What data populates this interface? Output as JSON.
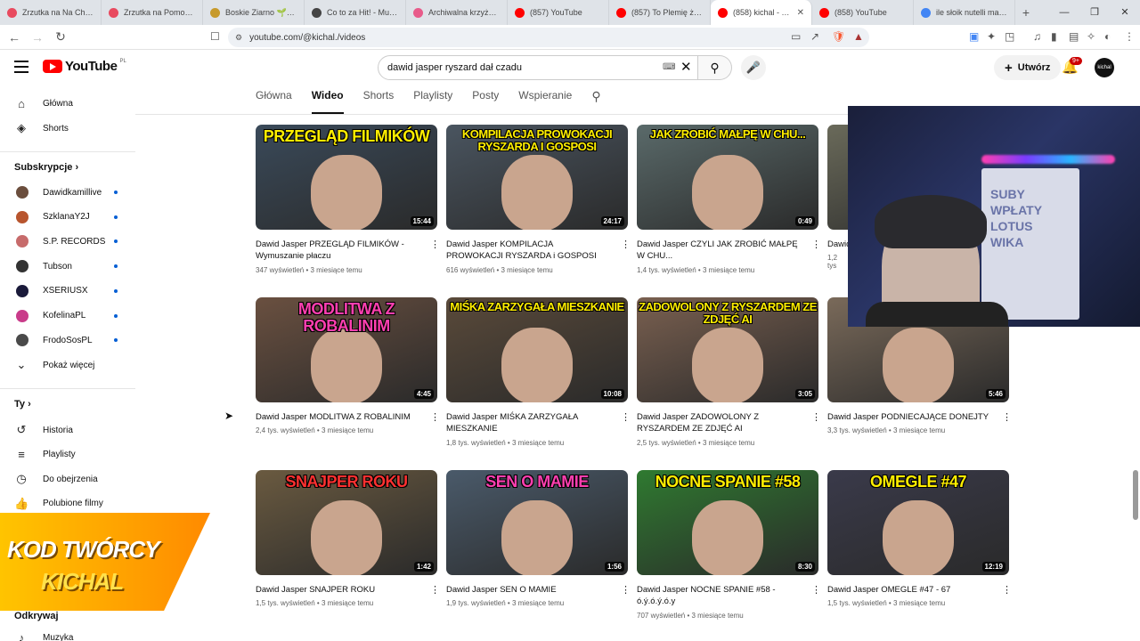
{
  "browser": {
    "tabs": [
      {
        "label": "Zrzutka na Na Chore D",
        "color": "#e84a5f",
        "active": false
      },
      {
        "label": "Zrzutka na Pomoc dla",
        "color": "#e84a5f",
        "active": false
      },
      {
        "label": "Boskie Ziarno 🌱 Reko",
        "color": "#c79a2b",
        "active": false
      },
      {
        "label": "Co to za Hit! - Muzyc",
        "color": "#444444",
        "active": false
      },
      {
        "label": "Archiwalna krzyżówka",
        "color": "#e85b8a",
        "active": false
      },
      {
        "label": "(857) YouTube",
        "color": "#ff0000",
        "active": false
      },
      {
        "label": "(857) To Plemię żyje na",
        "color": "#ff0000",
        "active": false
      },
      {
        "label": "(858) kichal - YouT",
        "color": "#ff0000",
        "active": true
      },
      {
        "label": "(858) YouTube",
        "color": "#ff0000",
        "active": false
      },
      {
        "label": "ile słoik nutelli ma kca",
        "color": "#4285f4",
        "active": false
      }
    ],
    "url": "youtube.com/@kichal./videos"
  },
  "youtube": {
    "logo_text": "YouTube",
    "logo_region": "PL",
    "search_query": "dawid jasper ryszard dał czadu",
    "create_label": "Utwórz",
    "notif_count": "9+",
    "me_avatar": "kichal"
  },
  "sidebar": {
    "main": [
      {
        "label": "Główna",
        "icon": "⌂"
      },
      {
        "label": "Shorts",
        "icon": "◈"
      }
    ],
    "subs_heading": "Subskrypcje",
    "subs": [
      {
        "label": "Dawidkamillive",
        "color": "#6b4e3d"
      },
      {
        "label": "SzklanaY2J",
        "color": "#b8552e"
      },
      {
        "label": "S.P. RECORDS",
        "color": "#c76b6b"
      },
      {
        "label": "Tubson",
        "color": "#333333"
      },
      {
        "label": "XSERIUSX",
        "color": "#1a1a3a"
      },
      {
        "label": "KofelinaPL",
        "color": "#c93b8a"
      },
      {
        "label": "FrodoSosPL",
        "color": "#4a4a4a"
      }
    ],
    "show_more": "Pokaż więcej",
    "you_heading": "Ty",
    "you": [
      {
        "label": "Historia",
        "icon": "↺"
      },
      {
        "label": "Playlisty",
        "icon": "≡"
      },
      {
        "label": "Do obejrzenia",
        "icon": "◷"
      },
      {
        "label": "Polubione filmy",
        "icon": "👍"
      }
    ],
    "explore_heading": "Odkrywaj",
    "explore": [
      {
        "label": "Muzyka",
        "icon": "♪"
      }
    ]
  },
  "channel_tabs": [
    "Główna",
    "Wideo",
    "Shorts",
    "Playlisty",
    "Posty",
    "Wspieranie"
  ],
  "channel_tab_active": "Wideo",
  "videos": [
    {
      "thumb_title": "PRZEGLĄD FILMIKÓW",
      "thumb_color": "#ffee00",
      "bg": "#3a4a5a",
      "duration": "15:44",
      "title": "Dawid Jasper PRZEGLĄD FILMIKÓW - Wymuszanie płaczu",
      "views": "347 wyświetleń",
      "age": "3 miesiące temu"
    },
    {
      "thumb_title": "KOMPILACJA PROWOKACJI RYSZARDA I GOSPOSI",
      "thumb_color": "#ffee00",
      "bg": "#4a5560",
      "duration": "24:17",
      "title": "Dawid Jasper KOMPILACJA PROWOKACJI RYSZARDA i GOSPOSI",
      "views": "616 wyświetleń",
      "age": "3 miesiące temu"
    },
    {
      "thumb_title": "JAK ZROBIĆ MAŁPĘ W CHU...",
      "thumb_color": "#ffee00",
      "bg": "#5a6a6a",
      "duration": "0:49",
      "title": "Dawid Jasper CZYLI JAK ZROBIĆ MAŁPĘ W CHU...",
      "views": "1,4 tys. wyświetleń",
      "age": "3 miesiące temu"
    },
    {
      "thumb_title": "",
      "thumb_color": "#ffee00",
      "bg": "#6a6a5a",
      "duration": "",
      "title": "Dawid",
      "views": "1,2 tys",
      "age": ""
    },
    {
      "thumb_title": "MODLITWA Z ROBALINIM",
      "thumb_color": "#ff3fb0",
      "bg": "#6a5040",
      "duration": "4:45",
      "title": "Dawid Jasper MODLITWA Z ROBALINIM",
      "views": "2,4 tys. wyświetleń",
      "age": "3 miesiące temu"
    },
    {
      "thumb_title": "MIŚKA ZARZYGAŁA MIESZKANIE",
      "thumb_color": "#ffee00",
      "bg": "#5a4a3a",
      "duration": "10:08",
      "title": "Dawid Jasper MIŚKA ZARZYGAŁA MIESZKANIE",
      "views": "1,8 tys. wyświetleń",
      "age": "3 miesiące temu"
    },
    {
      "thumb_title": "ZADOWOLONY Z RYSZARDEM ZE ZDJĘĆ AI",
      "thumb_color": "#ffee00",
      "bg": "#7a6050",
      "duration": "3:05",
      "title": "Dawid Jasper ZADOWOLONY Z RYSZARDEM ZE ZDJĘĆ AI",
      "views": "2,5 tys. wyświetleń",
      "age": "3 miesiące temu"
    },
    {
      "thumb_title": "PO",
      "thumb_color": "#ffee00",
      "bg": "#7a6a5a",
      "duration": "5:46",
      "title": "Dawid Jasper PODNIECAJĄCE DONEJTY",
      "views": "3,3 tys. wyświetleń",
      "age": "3 miesiące temu"
    },
    {
      "thumb_title": "SNAJPER ROKU",
      "thumb_color": "#ff3030",
      "bg": "#6a5a40",
      "duration": "1:42",
      "title": "Dawid Jasper SNAJPER ROKU",
      "views": "1,5 tys. wyświetleń",
      "age": "3 miesiące temu"
    },
    {
      "thumb_title": "SEN O MAMIE",
      "thumb_color": "#ff3fb0",
      "bg": "#4a5a6a",
      "duration": "1:56",
      "title": "Dawid Jasper SEN O MAMIE",
      "views": "1,9 tys. wyświetleń",
      "age": "3 miesiące temu"
    },
    {
      "thumb_title": "NOCNE SPANIE #58",
      "thumb_color": "#ffee00",
      "bg": "#2f7a30",
      "duration": "8:30",
      "title": "Dawid Jasper NOCNE SPANIE #58 - ó.ý.ó.ý.ó.y",
      "views": "707 wyświetleń",
      "age": "3 miesiące temu"
    },
    {
      "thumb_title": "OMEGLE #47",
      "thumb_color": "#ffee00",
      "bg": "#3a3a4a",
      "duration": "12:19",
      "title": "Dawid Jasper OMEGLE #47 - 67",
      "views": "1,5 tys. wyświetleń",
      "age": "3 miesiące temu"
    }
  ],
  "overlay": {
    "creator_code_line1": "KOD TWÓRCY",
    "creator_code_line2": "KICHAL",
    "whiteboard_text": "SUBY\nWPŁATY\nLOTUS\nWIKA"
  }
}
